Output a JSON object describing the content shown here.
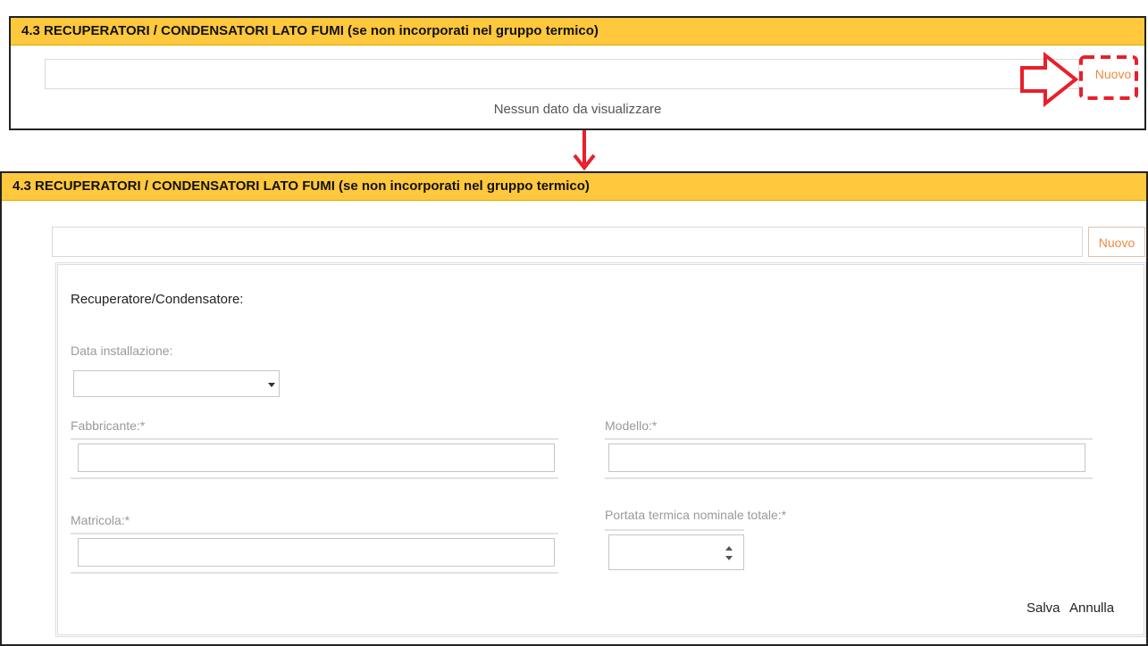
{
  "top_section": {
    "header": "4.3 RECUPERATORI / CONDENSATORI LATO FUMI (se non incorporati nel gruppo termico)",
    "new_button": "Nuovo",
    "empty_message": "Nessun dato da visualizzare"
  },
  "bottom_section": {
    "header": "4.3 RECUPERATORI / CONDENSATORI LATO FUMI (se non incorporati nel gruppo termico)",
    "new_button": "Nuovo",
    "form": {
      "title": "Recuperatore/Condensatore:",
      "install_date_label": "Data installazione:",
      "install_date_value": "",
      "manufacturer_label": "Fabbricante:*",
      "manufacturer_value": "",
      "model_label": "Modello:*",
      "model_value": "",
      "serial_label": "Matricola:*",
      "serial_value": "",
      "thermal_capacity_label": "Portata termica nominale totale:*",
      "thermal_capacity_value": "",
      "save_label": "Salva",
      "cancel_label": "Annulla"
    }
  },
  "annotation_colors": {
    "arrow": "#e8202a",
    "highlight": "#e8202a",
    "header_bg": "#ffc83d",
    "nuovo_text": "#f08a3c"
  },
  "icons": [
    "dropdown-chevron-icon",
    "spinner-up-icon",
    "spinner-down-icon",
    "callout-arrow-icon",
    "flow-arrow-icon"
  ]
}
